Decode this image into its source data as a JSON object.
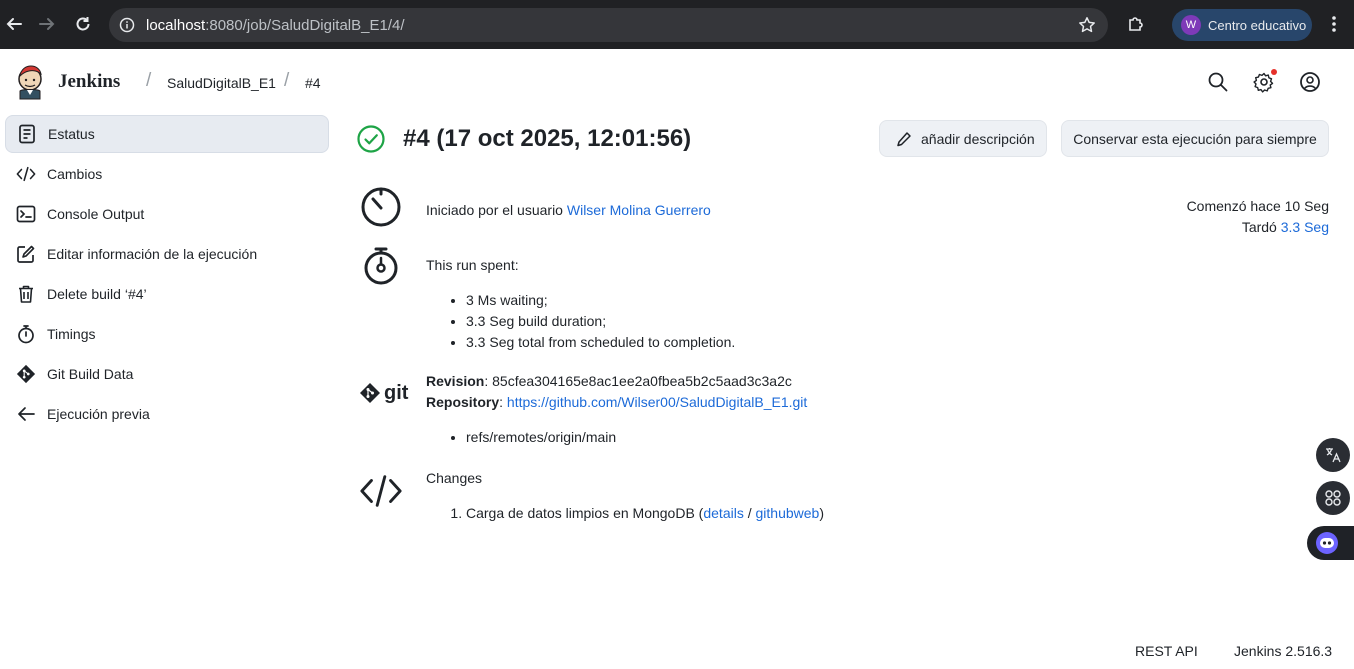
{
  "browser": {
    "url_host": "localhost",
    "url_path": ":8080/job/SaludDigitalB_E1/4/",
    "profile_initial": "W",
    "profile_name": "Centro educativo"
  },
  "header": {
    "app_name": "Jenkins",
    "breadcrumbs": [
      "SaludDigitalB_E1",
      "#4"
    ]
  },
  "sidebar": {
    "items": [
      {
        "label": "Estatus",
        "icon": "document-icon",
        "active": true
      },
      {
        "label": "Cambios",
        "icon": "code-icon"
      },
      {
        "label": "Console Output",
        "icon": "terminal-icon"
      },
      {
        "label": "Editar información de la ejecución",
        "icon": "edit-icon"
      },
      {
        "label": "Delete build ‘#4’",
        "icon": "trash-icon"
      },
      {
        "label": "Timings",
        "icon": "stopwatch-icon"
      },
      {
        "label": "Git Build Data",
        "icon": "git-icon"
      },
      {
        "label": "Ejecución previa",
        "icon": "arrow-left-icon"
      }
    ]
  },
  "build": {
    "title": "#4 (17 oct 2025, 12:01:56)",
    "status": "success",
    "add_description_label": "añadir descripción",
    "keep_forever_label": "Conservar esta ejecución para siempre",
    "started_label": "Comenzó hace 10 Seg",
    "took_prefix": "Tardó ",
    "took_value": "3.3 Seg",
    "started_by_prefix": "Iniciado por el usuario ",
    "started_by_user": "Wilser Molina Guerrero",
    "run_spent_label": "This run spent:",
    "run_spent_items": [
      "3 Ms waiting;",
      "3.3 Seg build duration;",
      "3.3 Seg total from scheduled to completion."
    ],
    "git_logo_text": "git",
    "revision_label": "Revision",
    "revision_value": "85cfea304165e8ac1ee2a0fbea5b2c5aad3c3a2c",
    "repository_label": "Repository",
    "repository_url": "https://github.com/Wilser00/SaludDigitalB_E1.git",
    "branches": [
      "refs/remotes/origin/main"
    ],
    "changes_label": "Changes",
    "changes": [
      {
        "message": "Carga de datos limpios en MongoDB",
        "details_link": "details",
        "githubweb_link": "githubweb"
      }
    ]
  },
  "footer": {
    "rest_api": "REST API",
    "version": "Jenkins 2.516.3"
  },
  "colors": {
    "link": "#1c6ad8",
    "success": "#1ea446",
    "browser_bg": "#202124"
  }
}
